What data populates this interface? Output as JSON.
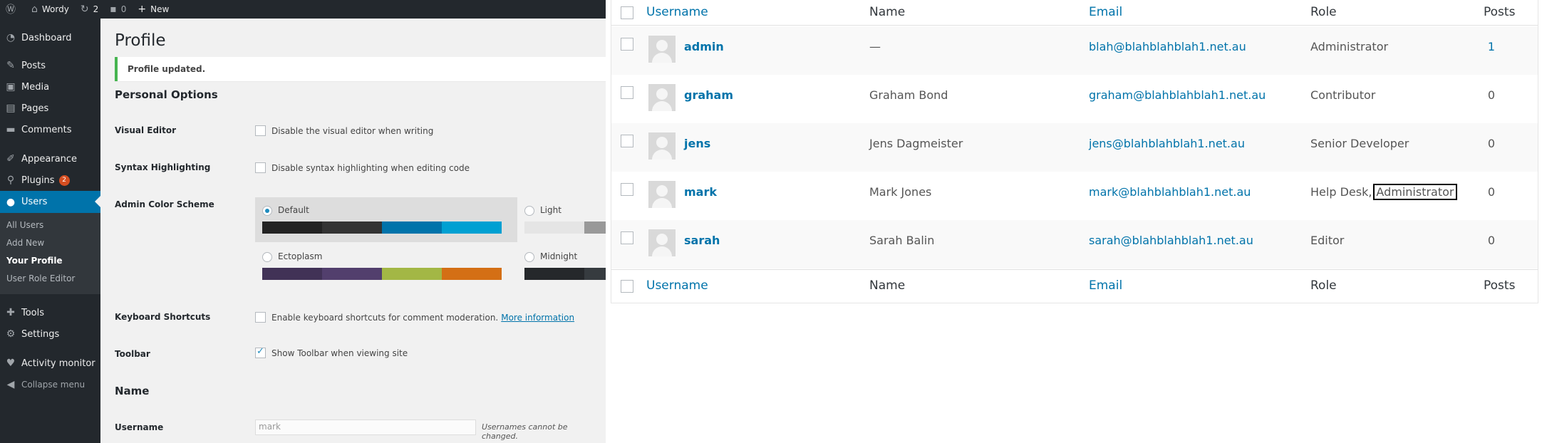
{
  "adminbar": {
    "site_name": "Wordy",
    "updates_count": "2",
    "comments_count": "0",
    "new_label": "New"
  },
  "menu": {
    "items": [
      {
        "label": "Dashboard",
        "icon": "dashboard-icon"
      },
      {
        "label": "Posts",
        "icon": "pin-icon"
      },
      {
        "label": "Media",
        "icon": "media-icon"
      },
      {
        "label": "Pages",
        "icon": "page-icon"
      },
      {
        "label": "Comments",
        "icon": "comment-icon"
      },
      {
        "label": "Appearance",
        "icon": "brush-icon"
      },
      {
        "label": "Plugins",
        "icon": "plugin-icon",
        "badge": "2"
      },
      {
        "label": "Users",
        "icon": "users-icon"
      },
      {
        "label": "Tools",
        "icon": "wrench-icon"
      },
      {
        "label": "Settings",
        "icon": "settings-icon"
      },
      {
        "label": "Activity monitor",
        "icon": "heart-icon"
      },
      {
        "label": "Collapse menu",
        "icon": "collapse-icon"
      }
    ],
    "submenu": [
      "All Users",
      "Add New",
      "Your Profile",
      "User Role Editor"
    ]
  },
  "profile": {
    "title": "Profile",
    "notice": "Profile updated.",
    "personal_options": "Personal Options",
    "visual_editor_label": "Visual Editor",
    "visual_editor_text": "Disable the visual editor when writing",
    "syntax_label": "Syntax Highlighting",
    "syntax_text": "Disable syntax highlighting when editing code",
    "color_scheme_label": "Admin Color Scheme",
    "schemes": [
      {
        "name": "Default",
        "selected": true,
        "colors": [
          "#222222",
          "#333333",
          "#0073aa",
          "#00a0d2"
        ]
      },
      {
        "name": "Light",
        "selected": false,
        "colors": [
          "#e5e5e5",
          "#999999",
          "#d64e07",
          "#04a4cc"
        ]
      },
      {
        "name": "Ectoplasm",
        "selected": false,
        "colors": [
          "#413256",
          "#523f6d",
          "#a3b745",
          "#d46f15"
        ]
      },
      {
        "name": "Midnight",
        "selected": false,
        "colors": [
          "#25282b",
          "#363b3f",
          "#69a8bb",
          "#e14d43"
        ]
      }
    ],
    "keyboard_label": "Keyboard Shortcuts",
    "keyboard_text": "Enable keyboard shortcuts for comment moderation.",
    "keyboard_link": "More information",
    "toolbar_label": "Toolbar",
    "toolbar_text": "Show Toolbar when viewing site",
    "name_heading": "Name",
    "username_label": "Username",
    "username_value": "mark",
    "username_desc": "Usernames cannot be changed."
  },
  "users_table": {
    "columns": [
      "Username",
      "Name",
      "Email",
      "Role",
      "Posts"
    ],
    "rows": [
      {
        "username": "admin",
        "name": "—",
        "email": "blah@blahblahblah1.net.au",
        "role": "Administrator",
        "posts": "1"
      },
      {
        "username": "graham",
        "name": "Graham Bond",
        "email": "graham@blahblahblah1.net.au",
        "role": "Contributor",
        "posts": "0"
      },
      {
        "username": "jens",
        "name": "Jens Dagmeister",
        "email": "jens@blahblahblah1.net.au",
        "role": "Senior Developer",
        "posts": "0"
      },
      {
        "username": "mark",
        "name": "Mark Jones",
        "email": "mark@blahblahblah1.net.au",
        "role": "Help Desk,",
        "role_extra": "Administrator",
        "posts": "0"
      },
      {
        "username": "sarah",
        "name": "Sarah Balin",
        "email": "sarah@blahblahblah1.net.au",
        "role": "Editor",
        "posts": "0"
      }
    ]
  }
}
